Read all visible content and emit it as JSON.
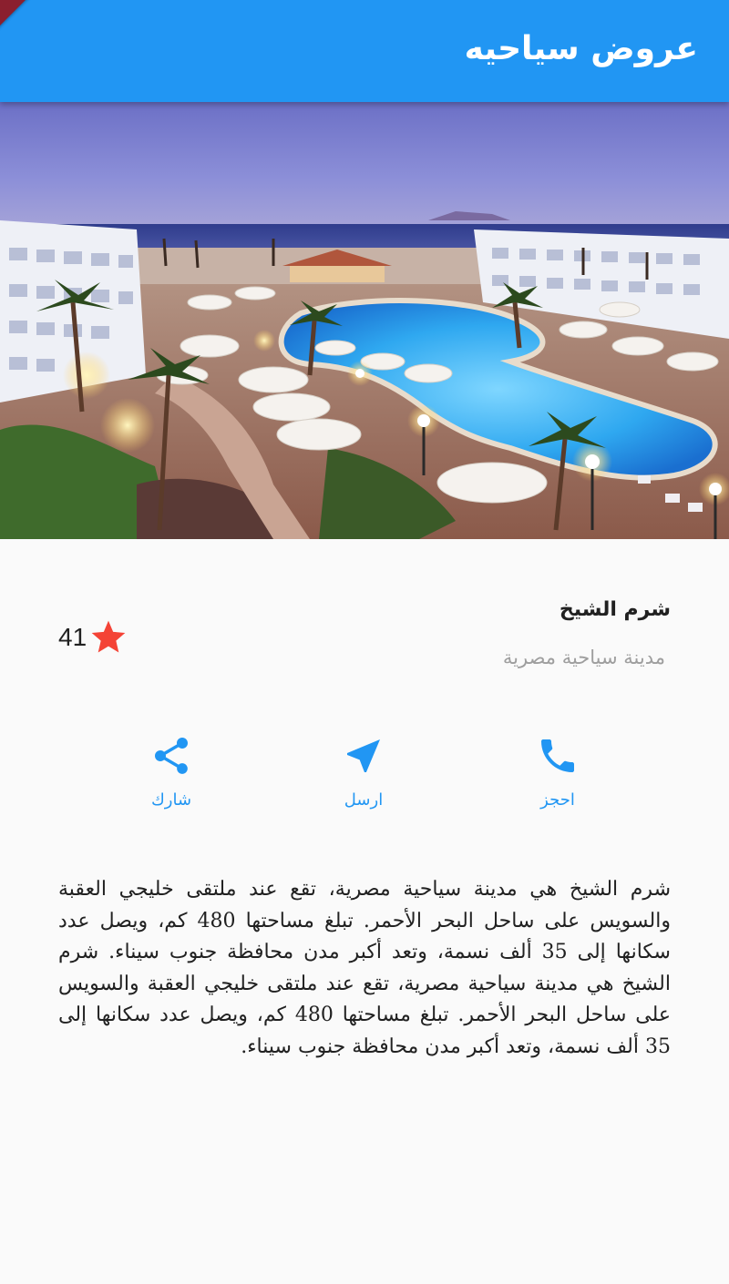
{
  "appbar": {
    "title": "عروض سياحيه",
    "color": "#2196f3",
    "debug_banner": "DEBUG"
  },
  "hero": {
    "image": "resort-pool-sharm-el-sheikh"
  },
  "place": {
    "title": "شرم الشيخ",
    "subtitle": "مدينة سياحية مصرية",
    "rating_count": "41",
    "star_color": "#f44336"
  },
  "actions": [
    {
      "label": "احجز",
      "icon": "phone-icon"
    },
    {
      "label": "ارسل",
      "icon": "navigation-icon"
    },
    {
      "label": "شارك",
      "icon": "share-icon"
    }
  ],
  "description": "شرم الشيخ هي مدينة سياحية مصرية، تقع عند ملتقى خليجي العقبة والسويس على ساحل البحر الأحمر. تبلغ مساحتها 480 كم، ويصل عدد سكانها إلى 35 ألف نسمة، وتعد أكبر مدن محافظة جنوب سيناء. شرم الشيخ هي مدينة سياحية مصرية، تقع عند ملتقى خليجي العقبة والسويس على ساحل البحر الأحمر. تبلغ مساحتها 480 كم، ويصل عدد سكانها إلى 35 ألف نسمة، وتعد أكبر مدن محافظة جنوب سيناء."
}
